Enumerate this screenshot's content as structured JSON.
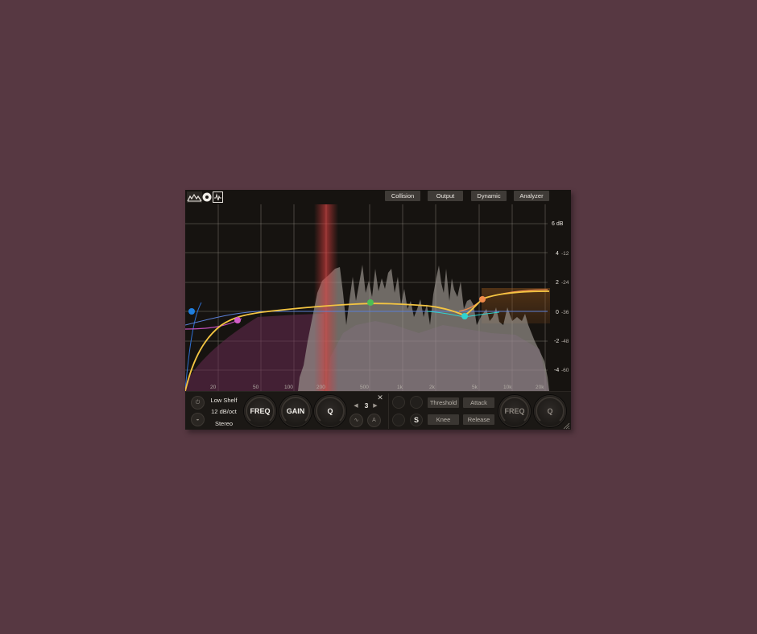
{
  "topbar": {
    "buttons": [
      "Collision",
      "Output",
      "Dynamic",
      "Analyzer"
    ]
  },
  "graph": {
    "db_labels": [
      "6 dB",
      "4",
      "2",
      "0",
      "-2",
      "-4"
    ],
    "analyzer_labels": [
      "-12",
      "-24",
      "-36",
      "-48",
      "-60"
    ],
    "freq_labels": [
      "20",
      "50",
      "100",
      "200",
      "500",
      "1k",
      "2k",
      "5k",
      "10k",
      "20k"
    ],
    "band_colors": [
      "#1f7fe0",
      "#d45cc9",
      "#4bbf55",
      "#31d3cf",
      "#f08a4a"
    ],
    "curve_color": "#f4c542"
  },
  "band_panel": {
    "filter_type": "Low Shelf",
    "slope": "12 dB/oct",
    "channel": "Stereo",
    "band_number": "3",
    "prev_arrow": "◀",
    "next_arrow": "▶",
    "close": "✕",
    "knobs": [
      "FREQ",
      "GAIN",
      "Q"
    ]
  },
  "dynamic_panel": {
    "solo_label": "S",
    "params": [
      "Threshold",
      "Attack",
      "Knee",
      "Release"
    ],
    "knobs": [
      "FREQ",
      "Q"
    ]
  }
}
